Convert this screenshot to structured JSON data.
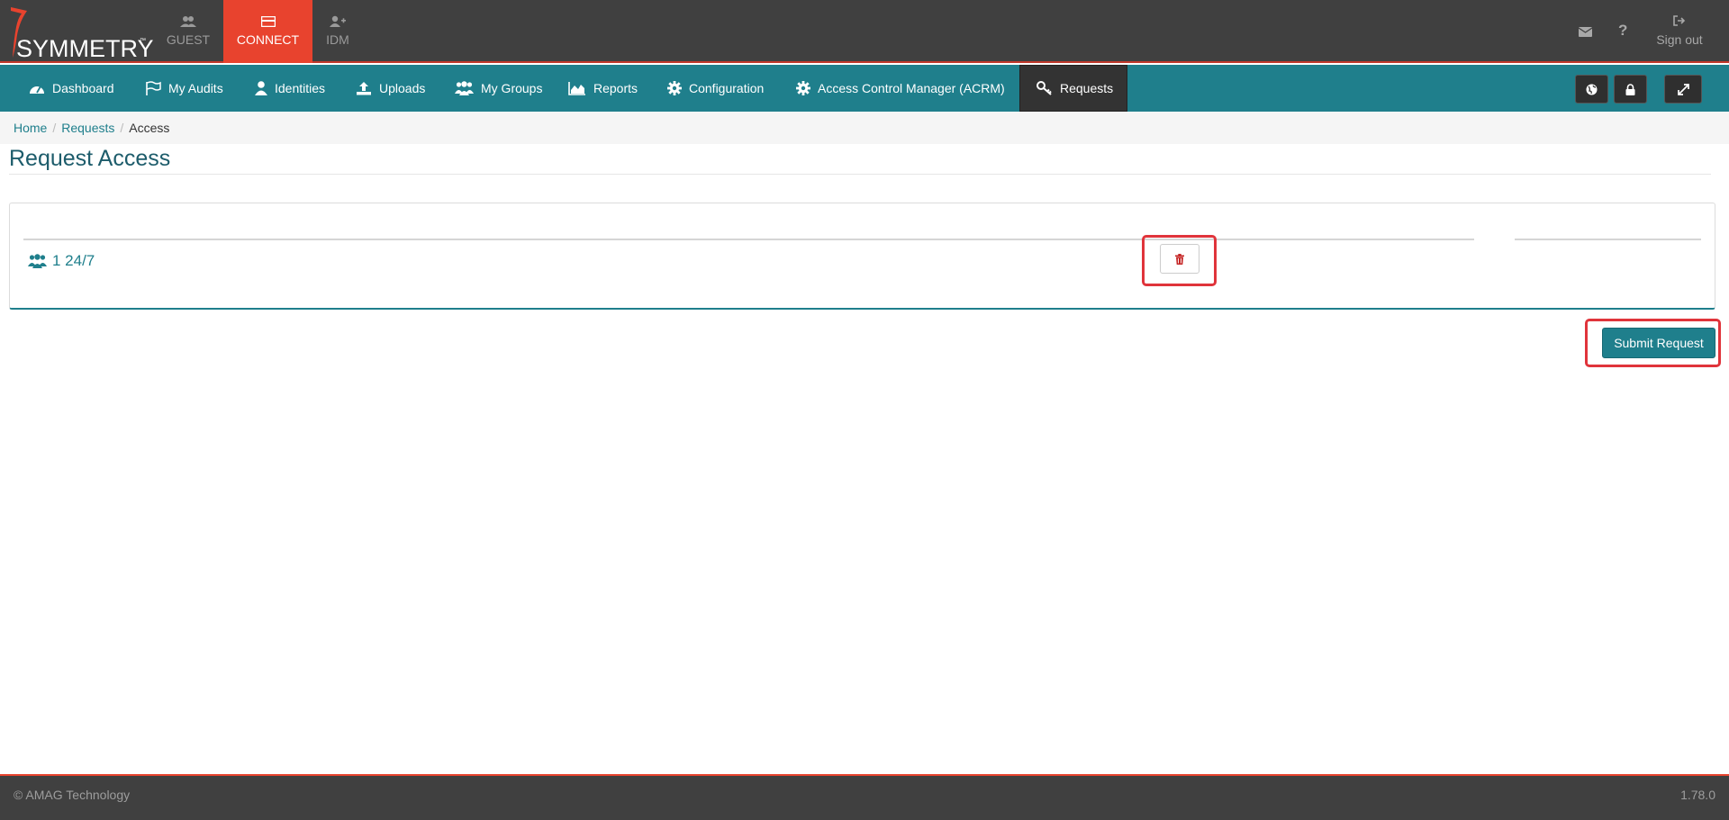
{
  "brand": {
    "logo_text": "SYMMETRY",
    "trademark": "™"
  },
  "modules": [
    {
      "label": "GUEST",
      "icon": "users-icon"
    },
    {
      "label": "CONNECT",
      "icon": "card-icon",
      "active": true
    },
    {
      "label": "IDM",
      "icon": "user-plus-icon"
    }
  ],
  "top_right": {
    "mail_icon": "envelope-icon",
    "help_glyph": "?",
    "signout_label": "Sign out"
  },
  "nav": {
    "items": [
      {
        "label": "Dashboard",
        "icon": "dashboard-icon"
      },
      {
        "label": "My Audits",
        "icon": "flag-icon"
      },
      {
        "label": "Identities",
        "icon": "user-icon"
      },
      {
        "label": "Uploads",
        "icon": "upload-icon"
      },
      {
        "label": "My Groups",
        "icon": "users-icon"
      },
      {
        "label": "Reports",
        "icon": "area-chart-icon"
      },
      {
        "label": "Configuration",
        "icon": "gear-icon"
      },
      {
        "label": "Access Control Manager (ACRM)",
        "icon": "gear-icon"
      },
      {
        "label": "Requests",
        "icon": "key-icon",
        "active": true
      }
    ],
    "right_buttons": [
      "globe-icon",
      "lock-icon",
      "expand-icon"
    ]
  },
  "breadcrumb": {
    "home": "Home",
    "requests": "Requests",
    "current": "Access",
    "separator": "/"
  },
  "page": {
    "title": "Request Access"
  },
  "request": {
    "group_label": "1 24/7"
  },
  "actions": {
    "submit_label": "Submit Request"
  },
  "footer": {
    "copyright": "© AMAG Technology",
    "version": "1.78.0"
  },
  "colors": {
    "teal": "#1f7f8c",
    "dark": "#404040",
    "accent_red": "#e8432e",
    "highlight_red": "#e0343b"
  }
}
